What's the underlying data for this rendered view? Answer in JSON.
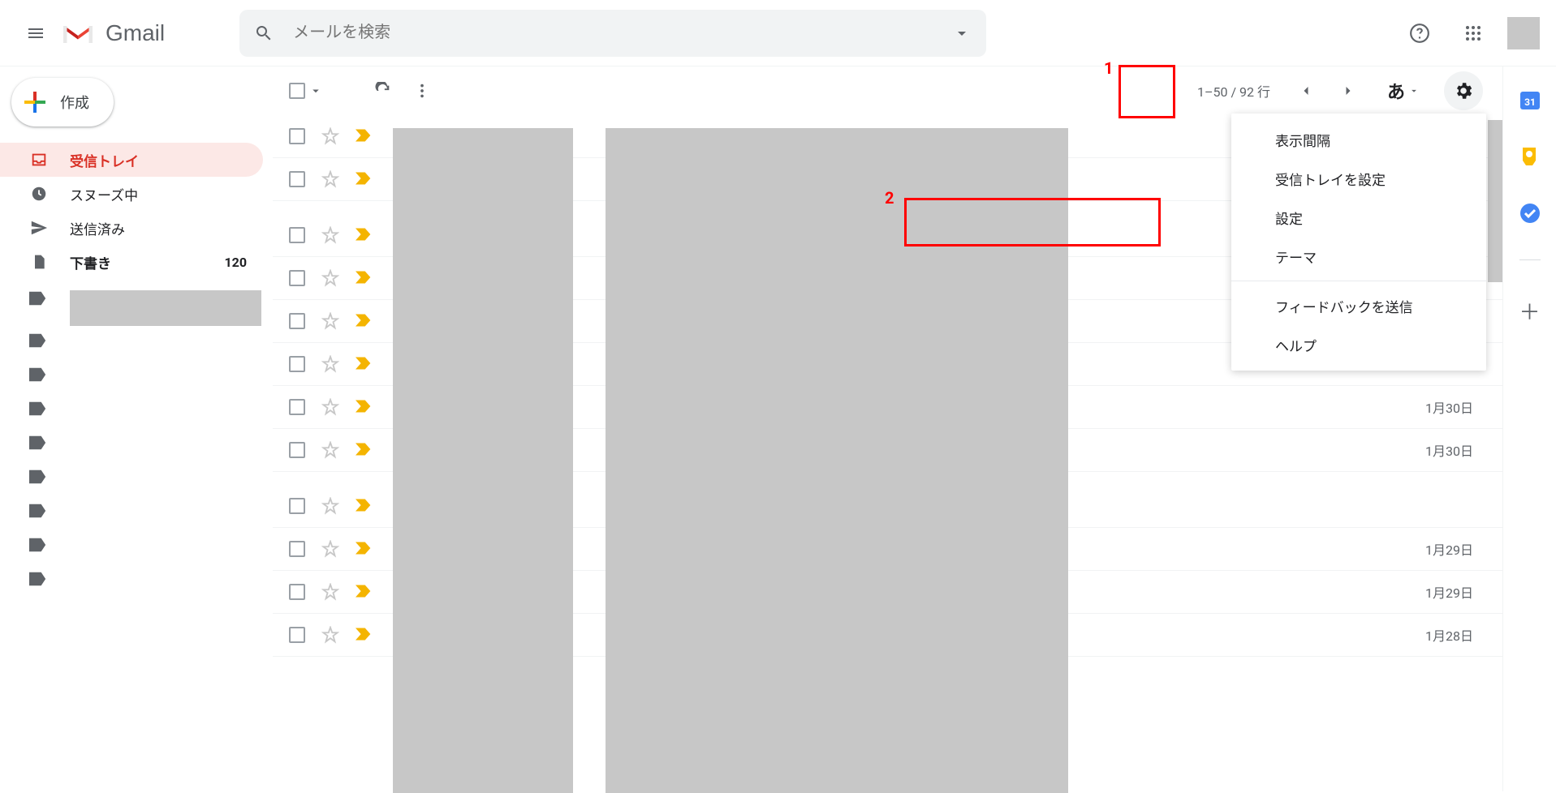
{
  "header": {
    "app_name": "Gmail",
    "search_placeholder": "メールを検索"
  },
  "sidebar": {
    "compose": "作成",
    "items": [
      {
        "label": "受信トレイ",
        "icon": "inbox",
        "count": ""
      },
      {
        "label": "スヌーズ中",
        "icon": "snoozed",
        "count": ""
      },
      {
        "label": "送信済み",
        "icon": "sent",
        "count": ""
      },
      {
        "label": "下書き",
        "icon": "drafts",
        "count": "120"
      }
    ]
  },
  "toolbar": {
    "page_range": "1–50 / 92 行",
    "input_lang": "あ"
  },
  "settings_menu": {
    "items": [
      "表示間隔",
      "受信トレイを設定",
      "設定",
      "テーマ",
      "フィードバックを送信",
      "ヘルプ"
    ]
  },
  "annotations": {
    "n1": "1",
    "n2": "2"
  },
  "mail_rows": [
    {
      "date": ""
    },
    {
      "date": ""
    },
    {
      "date": ""
    },
    {
      "date": ""
    },
    {
      "date": ""
    },
    {
      "date": ""
    },
    {
      "date": "1月30日"
    },
    {
      "date": "1月30日"
    },
    {
      "date": ""
    },
    {
      "date": "1月29日"
    },
    {
      "date": "1月29日"
    },
    {
      "date": "1月28日"
    }
  ],
  "rightpanel": {
    "calendar_day": "31"
  }
}
